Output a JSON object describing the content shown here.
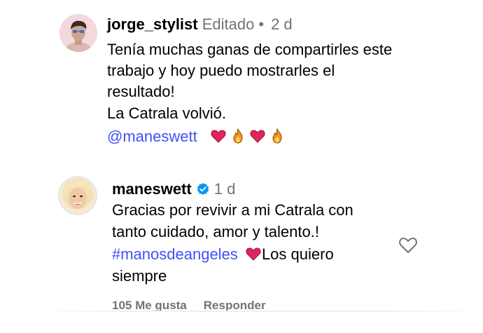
{
  "comment1": {
    "username": "jorge_stylist",
    "edited": "Editado",
    "separator": "•",
    "time": "2 d",
    "lines": [
      "Tenía muchas ganas de compartirles este",
      "trabajo y hoy puedo mostrarles el",
      "resultado!",
      "La Catrala volvió."
    ],
    "mention": "@maneswett",
    "emojis": [
      "red-heart",
      "fire",
      "red-heart",
      "fire"
    ]
  },
  "comment2": {
    "username": "maneswett",
    "verified": true,
    "time": "1 d",
    "lines": [
      "Gracias por revivir a mi Catrala con",
      "tanto cuidado, amor y talento.!"
    ],
    "hashtag": "#manosdeangeles",
    "after_hashtag": "Los quiero",
    "last_line": "siempre",
    "likes_label": "105 Me gusta",
    "reply_label": "Responder"
  },
  "colors": {
    "link": "#4150f7",
    "meta": "#737373",
    "verified": "#0095f6",
    "heart": "#e0245e",
    "fire": "#f7931e"
  }
}
